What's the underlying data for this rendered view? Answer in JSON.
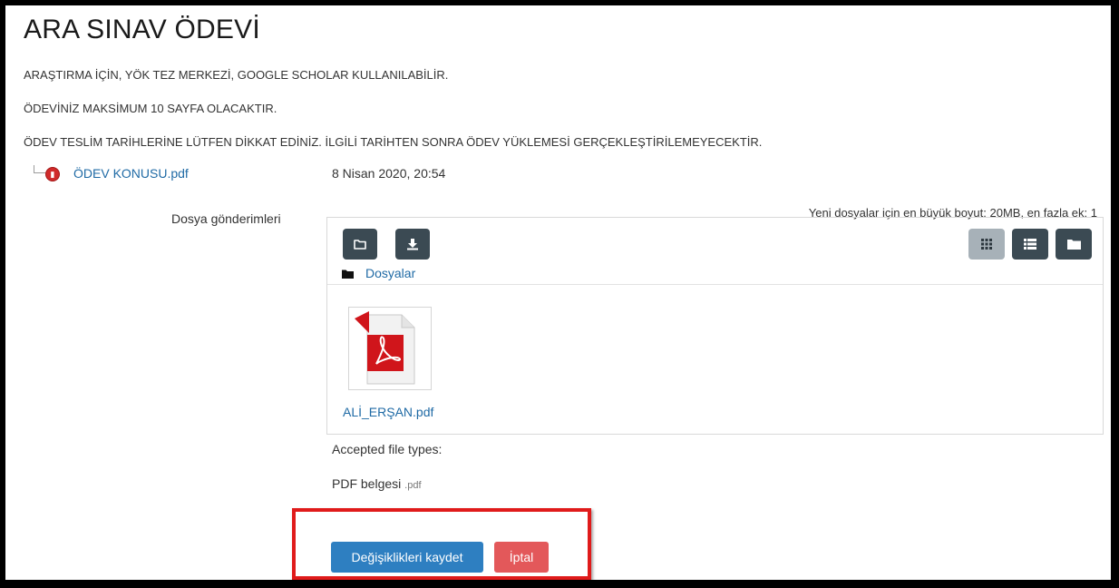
{
  "assignment": {
    "title": "ARA SINAV ÖDEVİ",
    "intro_lines": [
      "ARAŞTIRMA İÇİN, YÖK TEZ MERKEZİ, GOOGLE SCHOLAR KULLANILABİLİR.",
      "ÖDEVİNİZ MAKSİMUM 10 SAYFA OLACAKTIR.",
      "ÖDEV TESLİM TARİHLERİNE LÜTFEN DİKKAT EDİNİZ. İLGİLİ TARİHTEN SONRA ÖDEV YÜKLEMESİ GERÇEKLEŞTİRİLEMEYECEKTİR."
    ],
    "attachment": {
      "name": "ÖDEV KONUSU.pdf",
      "date": "8 Nisan 2020, 20:54"
    }
  },
  "submission": {
    "label": "Dosya gönderimleri",
    "max_size_note": "Yeni dosyalar için en büyük boyut: 20MB, en fazla ek: 1",
    "breadcrumb": "Dosyalar",
    "files": [
      {
        "name": "ALİ_ERŞAN.pdf",
        "icon": "pdf-file-icon"
      }
    ],
    "accepted_types_label": "Accepted file types:",
    "accepted_type": {
      "name": "PDF belgesi",
      "ext": ".pdf"
    }
  },
  "actions": {
    "save_label": "Değişiklikleri kaydet",
    "cancel_label": "İptal"
  },
  "colors": {
    "link": "#1f6aa5",
    "primary": "#2e7fc1",
    "danger": "#e3585a",
    "dark_button": "#3b4a53",
    "highlight": "#e01b1b"
  }
}
